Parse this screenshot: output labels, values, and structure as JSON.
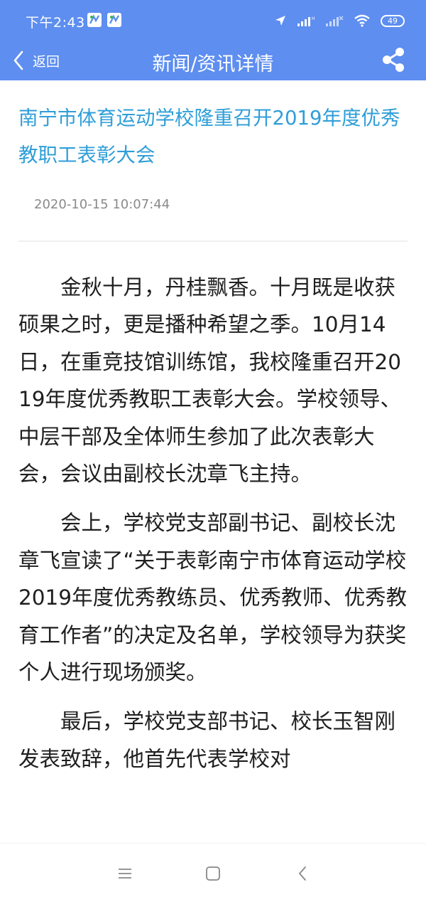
{
  "status_bar": {
    "time": "下午2:43",
    "battery": "49"
  },
  "nav": {
    "back_label": "返回",
    "title": "新闻/资讯详情"
  },
  "article": {
    "title": "南宁市体育运动学校隆重召开2019年度优秀教职工表彰大会",
    "date": "2020-10-15 10:07:44",
    "paragraphs": [
      "金秋十月，丹桂飘香。十月既是收获硕果之时，更是播种希望之季。10月14日，在重竞技馆训练馆，我校隆重召开2019年度优秀教职工表彰大会。学校领导、中层干部及全体师生参加了此次表彰大会，会议由副校长沈章飞主持。",
      "会上，学校党支部副书记、副校长沈章飞宣读了“关于表彰南宁市体育运动学校2019年度优秀教练员、优秀教师、优秀教育工作者”的决定及名单，学校领导为获奖个人进行现场颁奖。",
      "最后，学校党支部书记、校长玉智刚发表致辞，他首先代表学校对"
    ]
  },
  "colors": {
    "header_bg": "#5d8ef0",
    "title_color": "#2f9ed8",
    "text_color": "#1f1f1f",
    "date_color": "#8a8a8a"
  },
  "icons": {
    "back": "chevron-left-icon",
    "share": "share-icon",
    "menu": "menu-icon",
    "home": "home-square-icon",
    "system_back": "system-back-icon"
  }
}
